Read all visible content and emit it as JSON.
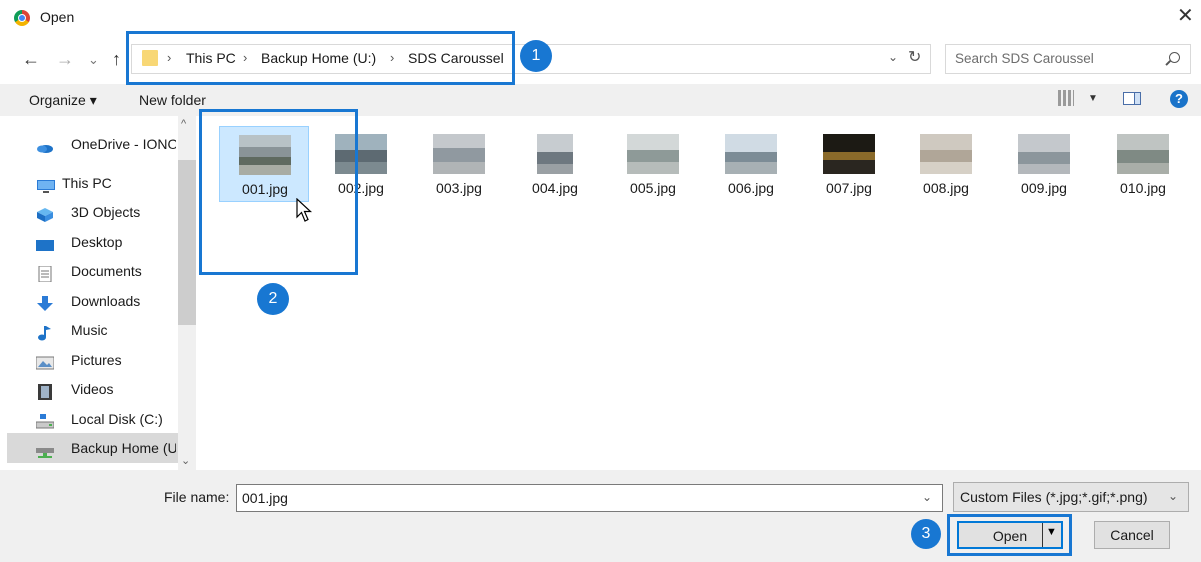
{
  "window": {
    "title": "Open",
    "close_glyph": "✕"
  },
  "nav_buttons": {
    "back": "←",
    "forward": "→",
    "recent": "⌄",
    "up": "↑"
  },
  "address_bar": {
    "segments": [
      "This PC",
      "Backup Home (U:)",
      "SDS Caroussel"
    ],
    "separator": "›",
    "dropdown": "⌄",
    "refresh": "↻"
  },
  "search": {
    "placeholder": "Search SDS Caroussel"
  },
  "toolbar": {
    "organize": "Organize ▾",
    "new_folder": "New folder",
    "view_drop": "▼",
    "help": "?"
  },
  "nav_pane": {
    "items": [
      {
        "label": "OneDrive - IONOD",
        "icon": "onedrive-icon"
      },
      {
        "label": "This PC",
        "icon": "this-pc-icon"
      },
      {
        "label": "3D Objects",
        "icon": "3d-objects-icon"
      },
      {
        "label": "Desktop",
        "icon": "desktop-icon"
      },
      {
        "label": "Documents",
        "icon": "documents-icon"
      },
      {
        "label": "Downloads",
        "icon": "downloads-icon"
      },
      {
        "label": "Music",
        "icon": "music-icon"
      },
      {
        "label": "Pictures",
        "icon": "pictures-icon"
      },
      {
        "label": "Videos",
        "icon": "videos-icon"
      },
      {
        "label": "Local Disk (C:)",
        "icon": "local-disk-icon"
      },
      {
        "label": "Backup Home (U",
        "icon": "network-drive-icon",
        "selected": true
      }
    ],
    "scroll_up": "^",
    "scroll_down": "⌄"
  },
  "files": [
    {
      "name": "001.jpg",
      "selected": true
    },
    {
      "name": "002.jpg"
    },
    {
      "name": "003.jpg"
    },
    {
      "name": "004.jpg"
    },
    {
      "name": "005.jpg"
    },
    {
      "name": "006.jpg"
    },
    {
      "name": "007.jpg"
    },
    {
      "name": "008.jpg"
    },
    {
      "name": "009.jpg"
    },
    {
      "name": "010.jpg"
    }
  ],
  "annotations": {
    "step1": "1",
    "step2": "2",
    "step3": "3"
  },
  "footer": {
    "file_name_label": "File name:",
    "file_name_value": "001.jpg",
    "file_type": "Custom Files (*.jpg;*.gif;*.png)",
    "dropdown_glyph": "⌄",
    "open_label": "Open",
    "open_split_arrow": "▼",
    "cancel_label": "Cancel"
  },
  "colors": {
    "accent": "#1877d2",
    "selection": "#cce8ff",
    "chrome_bg": "#f0f0f0"
  }
}
